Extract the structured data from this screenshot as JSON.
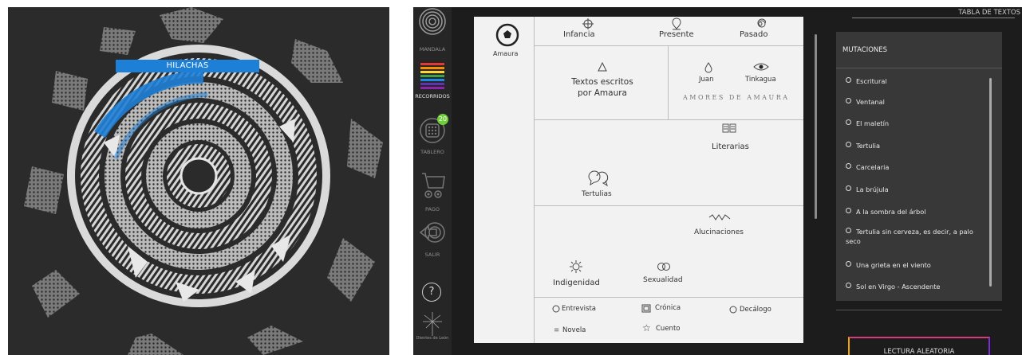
{
  "mandala": {
    "banner_label": "HILACHAS"
  },
  "sidebar": {
    "mandala_label": "MANDALA",
    "recorridos_label": "RECORRIDOS",
    "tablero_label": "TABLERO",
    "tablero_badge": "20",
    "pago_label": "PAGO",
    "salir_label": "SALIR",
    "help_label": "?",
    "logo_text": "Dientes de León"
  },
  "card": {
    "author": "Amaura",
    "times": [
      "Infancia",
      "Presente",
      "Pasado"
    ],
    "written_by": "Textos escritos por Amaura",
    "loves": [
      "Juan",
      "Tinkagua"
    ],
    "loves_title": "AMORES DE AMAURA",
    "literarias": "Literarias",
    "tertulias": "Tertulias",
    "alucinaciones": "Alucinaciones",
    "indigenidad": "Indigenidad",
    "sexualidad": "Sexualidad",
    "genres": [
      "Entrevista",
      "Crónica",
      "Decálogo",
      "Novela",
      "Cuento"
    ]
  },
  "right": {
    "table_title": "TABLA DE TEXTOS",
    "panel_title": "MUTACIONES",
    "items": [
      "Escritural",
      "Ventanal",
      "El maletín",
      "Tertulia",
      "Carcelaria",
      "La brújula",
      "A la sombra del árbol",
      "Tertulia sin cerveza, es decir, a palo seco",
      "Una grieta en el viento",
      "Sol en Virgo - Ascendente"
    ],
    "random_button": "LECTURA ALEATORIA"
  },
  "colors": {
    "accent_blue": "#1e7fd6",
    "badge_green": "#6fcf3a",
    "panel_dark": "#383838"
  }
}
